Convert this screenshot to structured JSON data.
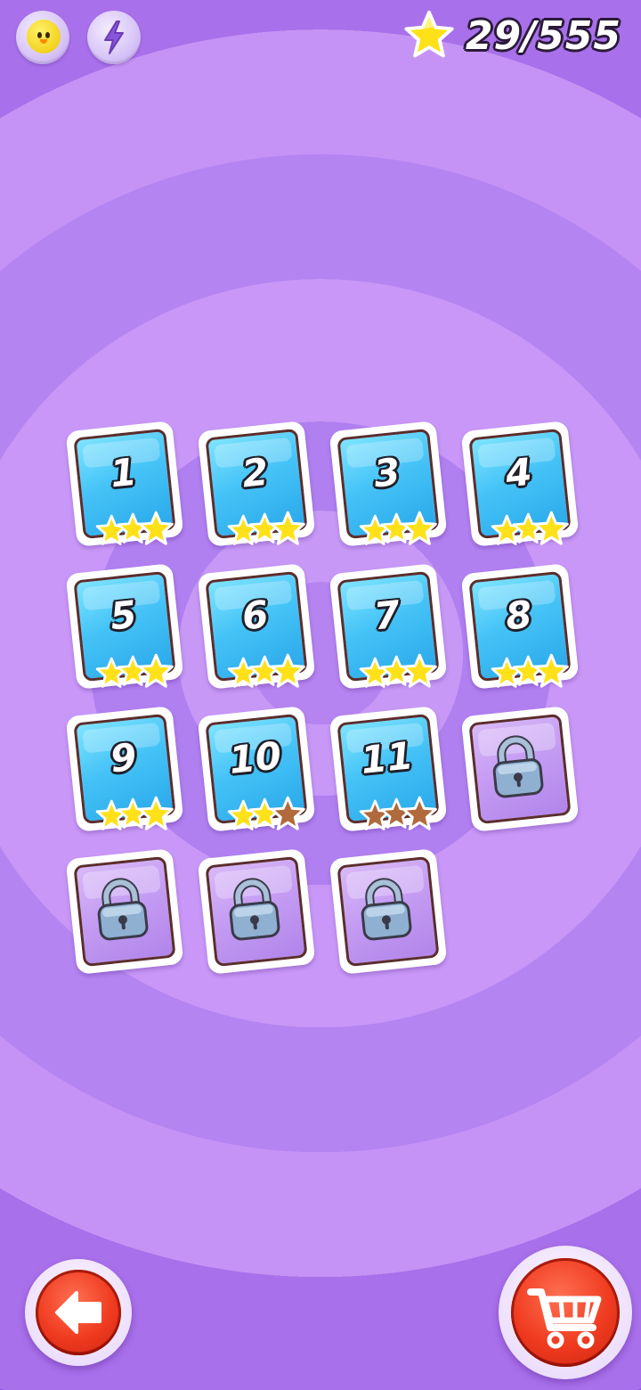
{
  "header": {
    "profile_icon": "chick-avatar-icon",
    "energy_icon": "lightning-bolt-icon",
    "stars_collected": "29/555"
  },
  "levels": [
    {
      "number": "1",
      "locked": false,
      "stars": 3
    },
    {
      "number": "2",
      "locked": false,
      "stars": 3
    },
    {
      "number": "3",
      "locked": false,
      "stars": 3
    },
    {
      "number": "4",
      "locked": false,
      "stars": 3
    },
    {
      "number": "5",
      "locked": false,
      "stars": 3
    },
    {
      "number": "6",
      "locked": false,
      "stars": 3
    },
    {
      "number": "7",
      "locked": false,
      "stars": 3
    },
    {
      "number": "8",
      "locked": false,
      "stars": 3
    },
    {
      "number": "9",
      "locked": false,
      "stars": 3
    },
    {
      "number": "10",
      "locked": false,
      "stars": 2
    },
    {
      "number": "11",
      "locked": false,
      "stars": 0
    },
    {
      "number": "",
      "locked": true,
      "stars": 0
    },
    {
      "number": "",
      "locked": true,
      "stars": 0
    },
    {
      "number": "",
      "locked": true,
      "stars": 0
    },
    {
      "number": "",
      "locked": true,
      "stars": 0
    }
  ],
  "footer": {
    "back_icon": "back-arrow-icon",
    "shop_icon": "shopping-cart-icon"
  },
  "colors": {
    "star_earned": "#ffe11a",
    "star_empty": "#b06a3c",
    "tile_unlocked": "#45c3f7",
    "tile_locked": "#c39af2",
    "button_red": "#ef3a1f"
  }
}
